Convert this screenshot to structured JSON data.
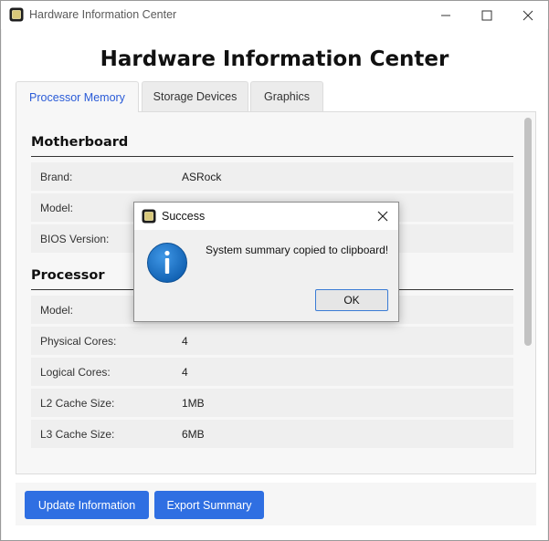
{
  "window": {
    "title": "Hardware Information Center",
    "icon": "chip-icon"
  },
  "main": {
    "heading": "Hardware Information Center",
    "tabs": [
      {
        "label": "Processor Memory",
        "active": true
      },
      {
        "label": "Storage Devices",
        "active": false
      },
      {
        "label": "Graphics",
        "active": false
      }
    ],
    "sections": {
      "motherboard": {
        "title": "Motherboard",
        "rows": [
          {
            "label": "Brand:",
            "value": "ASRock"
          },
          {
            "label": "Model:",
            "value": ""
          },
          {
            "label": "BIOS Version:",
            "value": ""
          }
        ]
      },
      "processor": {
        "title": "Processor",
        "rows": [
          {
            "label": "Model:",
            "value": ""
          },
          {
            "label": "Physical Cores:",
            "value": "4"
          },
          {
            "label": "Logical Cores:",
            "value": "4"
          },
          {
            "label": "L2 Cache Size:",
            "value": "1MB"
          },
          {
            "label": "L3 Cache Size:",
            "value": "6MB"
          }
        ]
      }
    }
  },
  "actions": {
    "update_label": "Update Information",
    "export_label": "Export Summary"
  },
  "dialog": {
    "title": "Success",
    "message": "System summary copied to clipboard!",
    "ok_label": "OK",
    "icon": "info-icon"
  },
  "colors": {
    "accent": "#2f6fe2",
    "active_tab_text": "#2a5bd7",
    "info_blue": "#1e73c8"
  }
}
